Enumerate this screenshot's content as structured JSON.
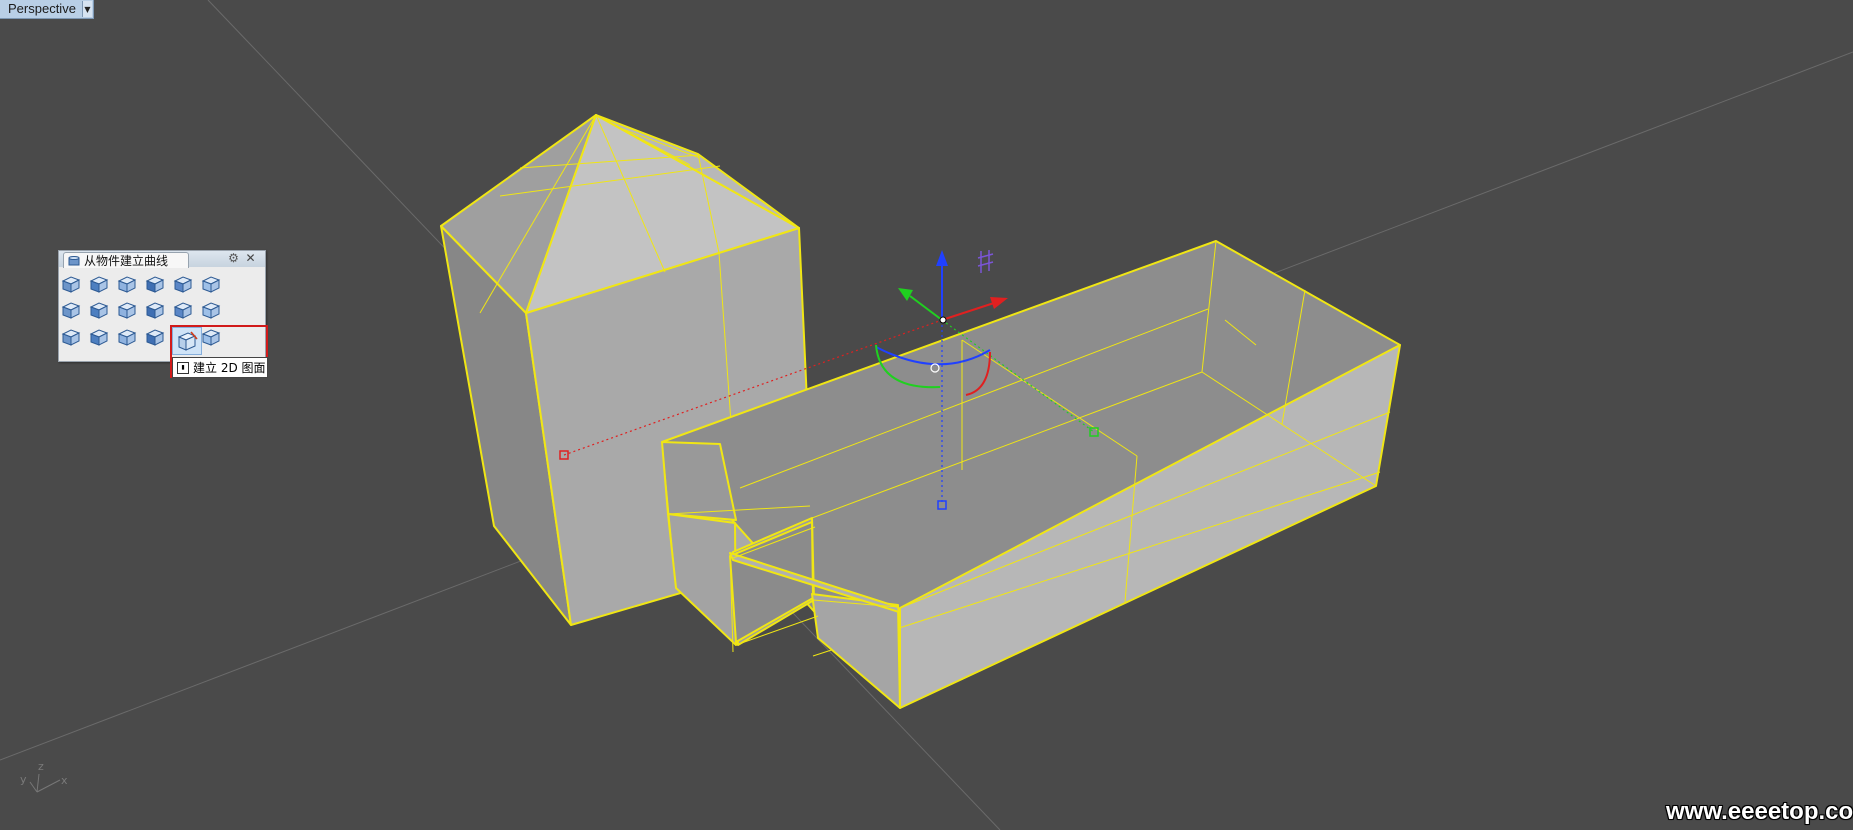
{
  "viewport": {
    "name": "Perspective",
    "background": "#4a4a4a",
    "selection_color": "#f0e614"
  },
  "toolbar": {
    "title": "从物件建立曲线",
    "tools": [
      {
        "icon": "duplicate-edge-icon"
      },
      {
        "icon": "duplicate-border-icon"
      },
      {
        "icon": "flat-surface-icon"
      },
      {
        "icon": "contour-icon"
      },
      {
        "icon": "section-icon"
      },
      {
        "icon": "silhouette-icon"
      },
      {
        "icon": "extract-wireframe-icon"
      },
      {
        "icon": "extract-isocurve-icon"
      },
      {
        "icon": "project-curve-icon"
      },
      {
        "icon": "pull-curve-icon"
      },
      {
        "icon": "intersect-icon"
      },
      {
        "icon": "duplicate-face-border-icon"
      },
      {
        "icon": "mesh-outline-icon"
      },
      {
        "icon": "box-icon"
      },
      {
        "icon": "extract-points-icon"
      },
      {
        "icon": "point-cloud-icon"
      },
      {
        "icon": "unroll-icon"
      },
      {
        "icon": "mirror-icon"
      },
      {
        "icon": "make-2d-icon"
      }
    ],
    "tooltip": "建立 2D 图面"
  },
  "gumball": {
    "x_color": "#e02020",
    "y_color": "#20d020",
    "z_color": "#2040ff"
  },
  "axes_widget": {
    "x": "x",
    "y": "y",
    "z": "z"
  },
  "watermark": "www.eeeetop.com"
}
